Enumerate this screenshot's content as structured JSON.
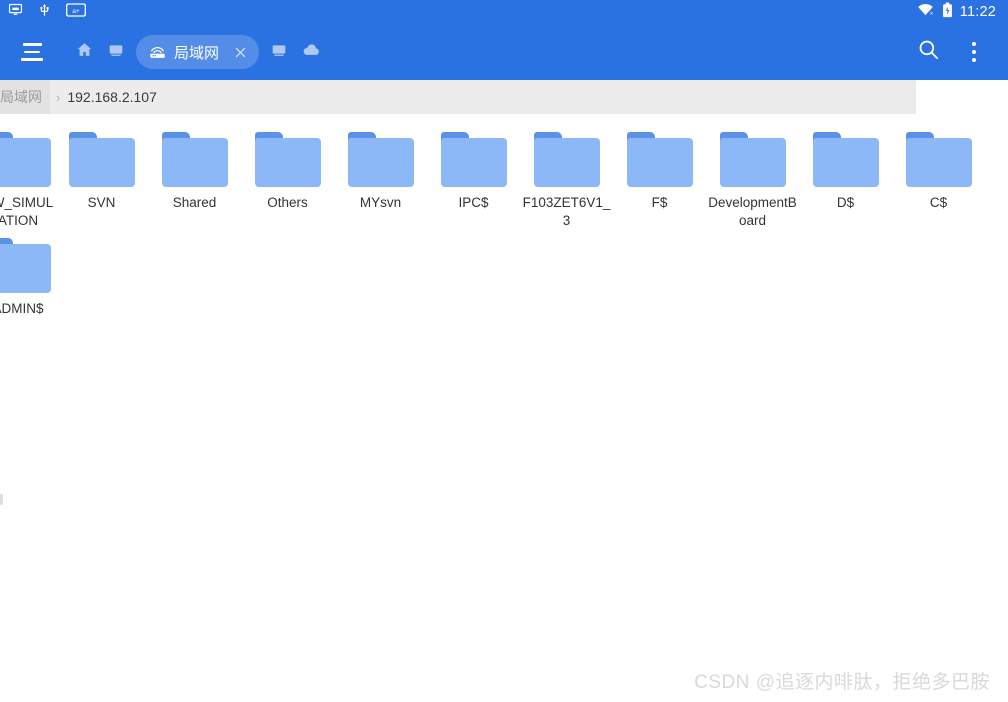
{
  "status_bar": {
    "left_icons": [
      {
        "name": "cast-screen-icon",
        "glyph": "cast"
      },
      {
        "name": "usb-icon",
        "glyph": "usb"
      },
      {
        "name": "adb-debug-icon",
        "glyph": "adb"
      }
    ],
    "right_icons": [
      {
        "name": "wifi-disconnected-icon",
        "glyph": "wifi-off"
      },
      {
        "name": "battery-icon",
        "glyph": "battery"
      }
    ],
    "time": "11:22"
  },
  "header": {
    "menu_button_name": "hamburger-menu-button",
    "tabs": [
      {
        "name": "tab-home",
        "icon": "home-icon",
        "label": "",
        "active": false
      },
      {
        "name": "tab-device-1",
        "icon": "device-icon",
        "label": "",
        "active": false
      },
      {
        "name": "tab-lan",
        "icon": "router-icon",
        "label": "局域网",
        "active": true,
        "close_label": "×"
      },
      {
        "name": "tab-device-2",
        "icon": "device-icon",
        "label": "",
        "active": false
      },
      {
        "name": "tab-cloud",
        "icon": "cloud-icon",
        "label": "",
        "active": false
      }
    ],
    "search_label": "search-icon",
    "overflow_label": "more-options-icon",
    "accent_color": "#2a71e2",
    "tab_active_bg": "rgba(255,255,255,0.20)"
  },
  "breadcrumb": {
    "root": "局域网",
    "separator": "›",
    "current": "192.168.2.107"
  },
  "file_grid": {
    "folder_color": "#8cb8f7",
    "folder_tab_color": "#5b92e8",
    "rows": [
      [
        {
          "name": "SW_SIMULATION"
        },
        {
          "name": "SVN"
        },
        {
          "name": "Shared"
        },
        {
          "name": "Others"
        },
        {
          "name": "MYsvn"
        },
        {
          "name": "IPC$"
        },
        {
          "name": "F103ZET6V1_3"
        },
        {
          "name": "F$"
        },
        {
          "name": "DevelopmentBoard"
        },
        {
          "name": "D$"
        },
        {
          "name": "C$"
        }
      ],
      [
        {
          "name": "ADMIN$"
        }
      ]
    ]
  },
  "watermark": {
    "text": "CSDN @追逐内啡肽，拒绝多巴胺"
  }
}
